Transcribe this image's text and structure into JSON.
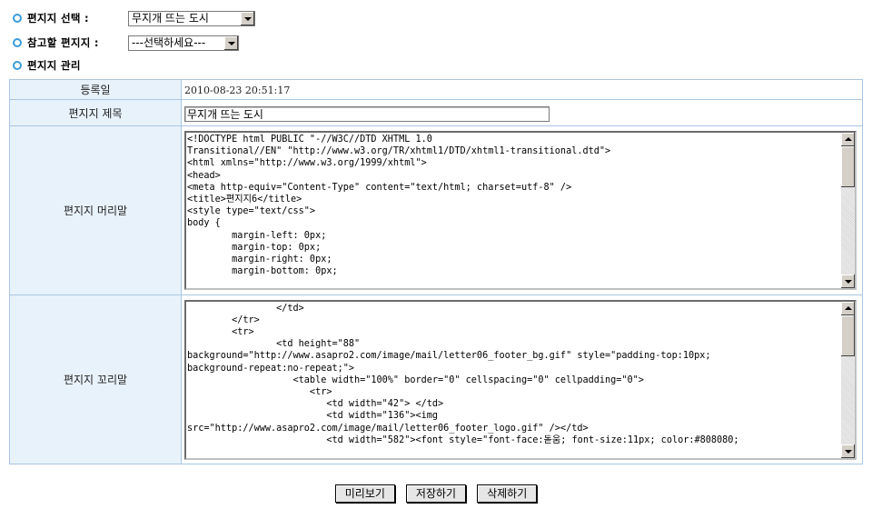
{
  "selectors": {
    "letter_select": {
      "label": "편지지 선택 :",
      "value": "무지개 뜨는 도시"
    },
    "reference_select": {
      "label": "참고할 편지지 :",
      "value": "---선택하세요---"
    },
    "manage_heading": "편지지 관리"
  },
  "table": {
    "reg_date": {
      "label": "등록일",
      "value": "2010-08-23 20:51:17"
    },
    "title": {
      "label": "편지지 제목",
      "value": "무지개 뜨는 도시"
    },
    "header": {
      "label": "편지지 머리말",
      "code": "<!DOCTYPE html PUBLIC \"-//W3C//DTD XHTML 1.0\nTransitional//EN\" \"http://www.w3.org/TR/xhtml1/DTD/xhtml1-transitional.dtd\">\n<html xmlns=\"http://www.w3.org/1999/xhtml\">\n<head>\n<meta http-equiv=\"Content-Type\" content=\"text/html; charset=utf-8\" />\n<title>편지지6</title>\n<style type=\"text/css\">\nbody {\n        margin-left: 0px;\n        margin-top: 0px;\n        margin-right: 0px;\n        margin-bottom: 0px;"
    },
    "footer": {
      "label": "편지지 꼬리말",
      "code": "                </td>\n        </tr>\n        <tr>\n                <td height=\"88\"\nbackground=\"http://www.asapro2.com/image/mail/letter06_footer_bg.gif\" style=\"padding-top:10px;\nbackground-repeat:no-repeat;\">\n                   <table width=\"100%\" border=\"0\" cellspacing=\"0\" cellpadding=\"0\">\n                      <tr>\n                         <td width=\"42\"> </td>\n                         <td width=\"136\"><img\nsrc=\"http://www.asapro2.com/image/mail/letter06_footer_logo.gif\" /></td>\n                         <td width=\"582\"><font style=\"font-face:돋움; font-size:11px; color:#808080;"
    }
  },
  "buttons": {
    "preview": "미리보기",
    "save": "저장하기",
    "delete": "삭제하기"
  },
  "colors": {
    "label_bg": "#e8f2fb",
    "border": "#a9c6e0",
    "bullet": "#3a9bdc"
  }
}
